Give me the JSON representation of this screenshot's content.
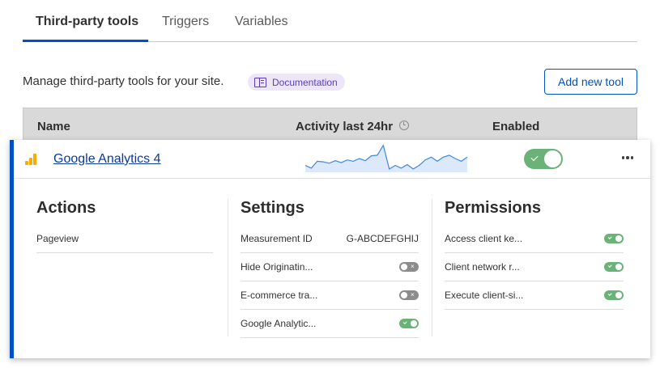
{
  "tabs": [
    {
      "label": "Third-party tools"
    },
    {
      "label": "Triggers"
    },
    {
      "label": "Variables"
    }
  ],
  "intro": {
    "description": "Manage third-party tools for your site.",
    "doc_link": "Documentation",
    "add_button": "Add new tool"
  },
  "table": {
    "headers": {
      "name": "Name",
      "activity": "Activity last 24hr",
      "enabled": "Enabled"
    }
  },
  "tool": {
    "name": "Google Analytics 4",
    "enabled": true,
    "activity_series": [
      0.25,
      0.15,
      0.4,
      0.38,
      0.33,
      0.42,
      0.35,
      0.45,
      0.4,
      0.5,
      0.42,
      0.6,
      0.62,
      0.98,
      0.12,
      0.25,
      0.15,
      0.28,
      0.12,
      0.25,
      0.45,
      0.55,
      0.4,
      0.55,
      0.62,
      0.5,
      0.4,
      0.55
    ],
    "accent_color": "#0051c3",
    "icon": "google-analytics-bars-icon"
  },
  "actions": {
    "title": "Actions",
    "items": [
      {
        "label": "Pageview"
      }
    ]
  },
  "settings": {
    "title": "Settings",
    "items": [
      {
        "label": "Measurement ID",
        "value": "G-ABCDEFGHIJ"
      },
      {
        "label": "Hide Originatin...",
        "toggle": false
      },
      {
        "label": "E-commerce tra...",
        "toggle": false
      },
      {
        "label": "Google Analytic...",
        "toggle": true
      }
    ]
  },
  "permissions": {
    "title": "Permissions",
    "items": [
      {
        "label": "Access client ke...",
        "toggle": true
      },
      {
        "label": "Client network r...",
        "toggle": true
      },
      {
        "label": "Execute client-si...",
        "toggle": true
      }
    ]
  },
  "colors": {
    "toggle_on": "#6ab278",
    "toggle_off": "#8c8c8c",
    "link": "#0a3a9c",
    "primary": "#0051c3"
  }
}
